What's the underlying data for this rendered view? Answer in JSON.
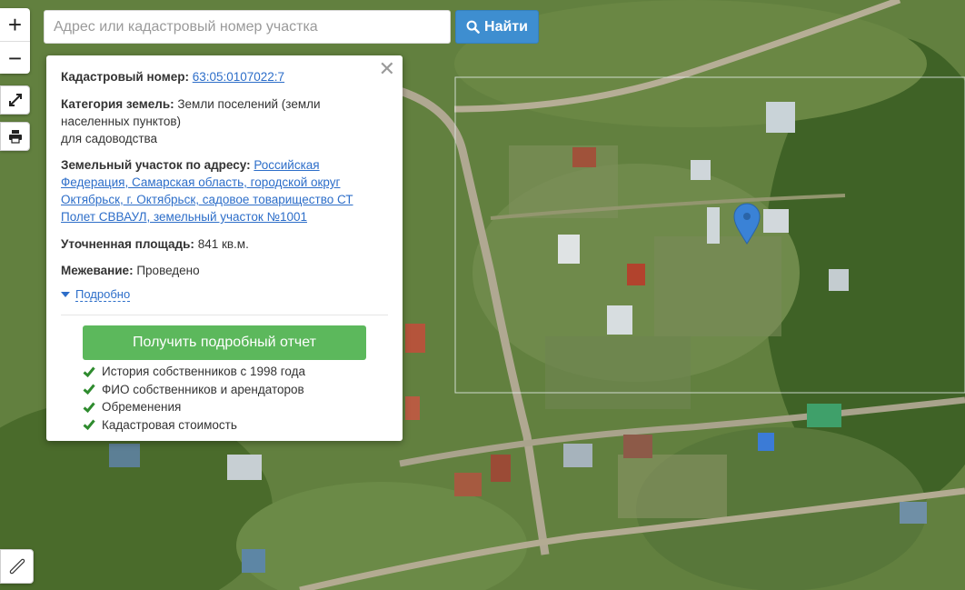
{
  "search": {
    "placeholder": "Адрес или кадастровый номер участка",
    "button_label": "Найти"
  },
  "map_controls": {
    "zoom_in": "+",
    "zoom_out": "−",
    "icons": [
      "fullscreen-icon",
      "print-icon",
      "ruler-icon"
    ]
  },
  "popup": {
    "cadastral_label": "Кадастровый номер:",
    "cadastral_value": "63:05:0107022:7",
    "category_label": "Категория земель:",
    "category_value": "Земли поселений (земли населенных пунктов)",
    "usage_value": "для садоводства",
    "address_label": "Земельный участок по адресу:",
    "address_value": "Российская Федерация, Самарская область, городской округ Октябрьск, г. Октябрьск, садовое товарищество СТ Полет СВВАУЛ, земельный участок №1001",
    "area_label": "Уточненная площадь:",
    "area_value": "841 кв.м.",
    "survey_label": "Межевание:",
    "survey_value": "Проведено",
    "more_label": "Подробно",
    "report_button": "Получить подробный отчет",
    "features": [
      "История собственников с 1998 года",
      "ФИО собственников и арендаторов",
      "Обременения",
      "Кадастровая стоимость"
    ]
  },
  "colors": {
    "primary_button": "#3e8ed0",
    "report_button": "#5cb85c",
    "link": "#2d6ec9",
    "check": "#2e8b2e",
    "marker": "#3a82d6"
  }
}
